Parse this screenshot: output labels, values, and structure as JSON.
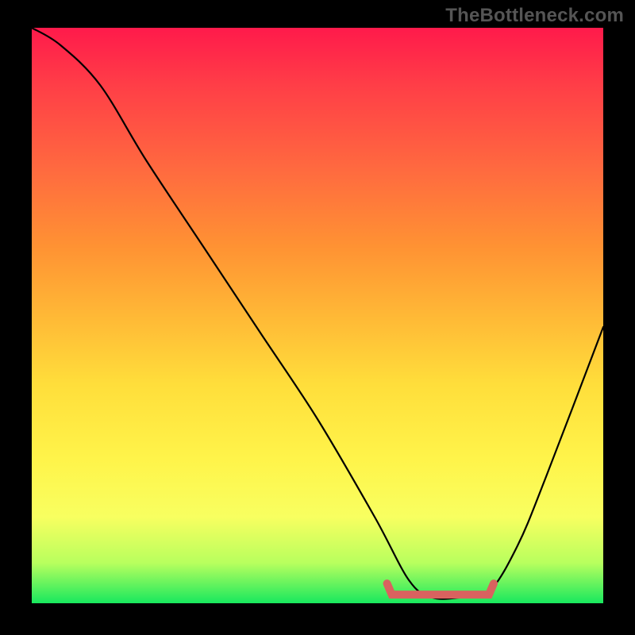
{
  "watermark": "TheBottleneck.com",
  "chart_data": {
    "type": "line",
    "title": "",
    "xlabel": "",
    "ylabel": "",
    "xlim": [
      0,
      100
    ],
    "ylim": [
      0,
      100
    ],
    "series": [
      {
        "name": "bottleneck-curve",
        "x": [
          0,
          5,
          12,
          20,
          30,
          40,
          50,
          60,
          66,
          70,
          75,
          80,
          85,
          90,
          100
        ],
        "values": [
          100,
          97,
          90,
          77,
          62,
          47,
          32,
          15,
          4,
          1,
          1,
          2,
          10,
          22,
          48
        ]
      }
    ],
    "valley_segment": {
      "name": "optimal-range",
      "x_start": 63,
      "x_end": 80,
      "y": 1.5
    },
    "gradient_stops": [
      {
        "pos": 0,
        "color": "#ff1a4b"
      },
      {
        "pos": 50,
        "color": "#ffb836"
      },
      {
        "pos": 85,
        "color": "#f8ff60"
      },
      {
        "pos": 100,
        "color": "#18e85e"
      }
    ]
  }
}
